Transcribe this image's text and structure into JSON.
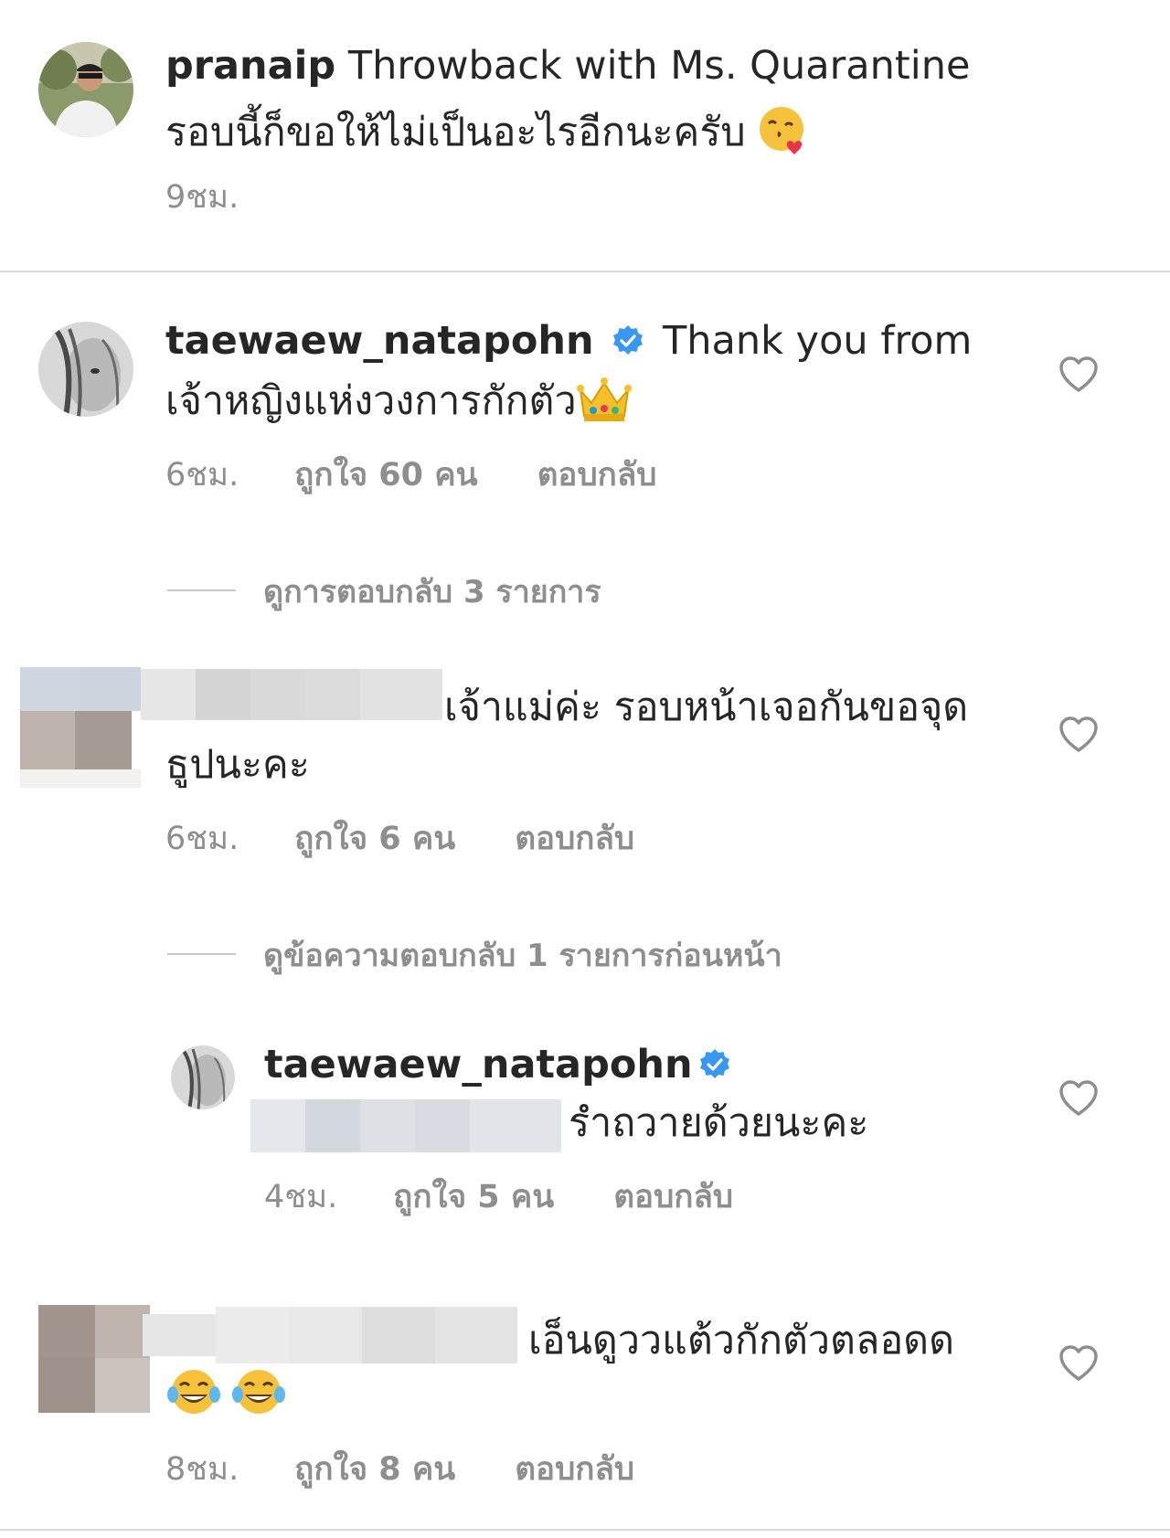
{
  "post": {
    "username": "pranaip",
    "caption_line1": "Throwback with Ms. Quarantine",
    "caption_line2": "รอบนี้ก็ขอให้ไม่เป็นอะไรอีกนะครับ",
    "emoji": "kissing-heart-emoji",
    "time": "9ชม."
  },
  "comments": [
    {
      "username": "taewaew_natapohn",
      "verified": true,
      "text_line1": "Thank you from",
      "text_line2": "เจ้าหญิงแห่งวงการกักตัว",
      "emoji": "crown-emoji",
      "time": "6ชม.",
      "likes": "ถูกใจ 60 คน",
      "reply": "ตอบกลับ",
      "view_replies": "ดูการตอบกลับ 3 รายการ"
    },
    {
      "username_hidden": true,
      "text_line1": "เจ้าแม่ค่ะ รอบหน้าเจอกันขอจุด",
      "text_line2": "ธูปนะคะ",
      "time": "6ชม.",
      "likes": "ถูกใจ 6 คน",
      "reply": "ตอบกลับ",
      "view_replies": "ดูข้อความตอบกลับ 1 รายการก่อนหน้า"
    },
    {
      "username": "taewaew_natapohn",
      "verified": true,
      "text_line2": "รำถวายด้วยนะคะ",
      "time": "4ชม.",
      "likes": "ถูกใจ 5 คน",
      "reply": "ตอบกลับ"
    },
    {
      "username_hidden": true,
      "text_line1": "เอ็นดูววแต้วกักตัวตลอดด",
      "emoji": "tears-of-joy-emoji",
      "time": "8ชม.",
      "likes": "ถูกใจ 8 คน",
      "reply": "ตอบกลับ"
    }
  ],
  "colors": {
    "text": "#262626",
    "meta": "#8e8e8e",
    "verified": "#3897f0",
    "divider": "#dbdbdb"
  }
}
